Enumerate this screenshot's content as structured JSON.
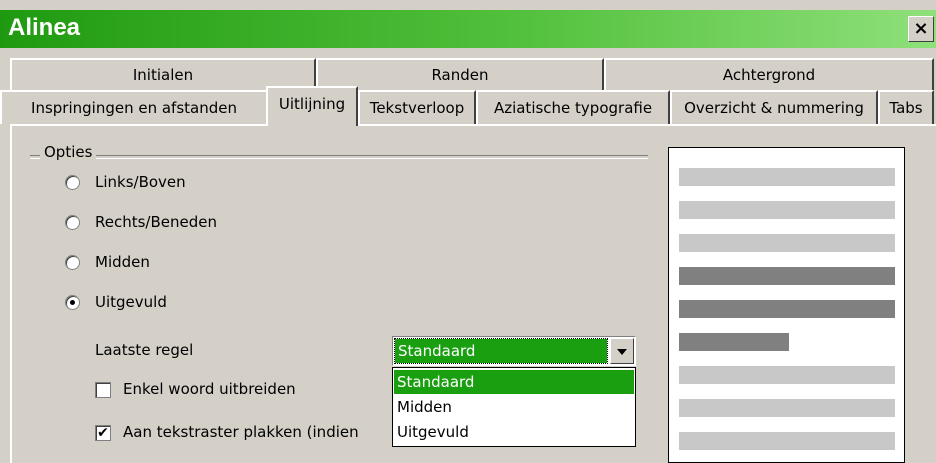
{
  "window": {
    "title": "Alinea",
    "close_label": "×"
  },
  "tabs_row1": [
    "Initialen",
    "Randen",
    "Achtergrond"
  ],
  "tabs_row2": [
    "Inspringingen en afstanden",
    "Uitlijning",
    "Tekstverloop",
    "Aziatische typografie",
    "Overzicht & nummering",
    "Tabs"
  ],
  "active_tab": "Uitlijning",
  "options": {
    "group_label": "Opties",
    "radios": [
      {
        "label": "Links/Boven",
        "selected": false
      },
      {
        "label": "Rechts/Beneden",
        "selected": false
      },
      {
        "label": "Midden",
        "selected": false
      },
      {
        "label": "Uitgevuld",
        "selected": true
      }
    ],
    "last_line_label": "Laatste regel",
    "last_line_value": "Standaard",
    "last_line_options": [
      "Standaard",
      "Midden",
      "Uitgevuld"
    ],
    "expand_single_word": {
      "label": "Enkel woord uitbreiden",
      "checked": false
    },
    "snap_to_grid": {
      "label": "Aan tekstraster plakken (indien",
      "checked": true
    }
  },
  "colors": {
    "titlebar_start": "#1f9a10",
    "titlebar_end": "#8fe07a",
    "highlight": "#1a9f10"
  }
}
